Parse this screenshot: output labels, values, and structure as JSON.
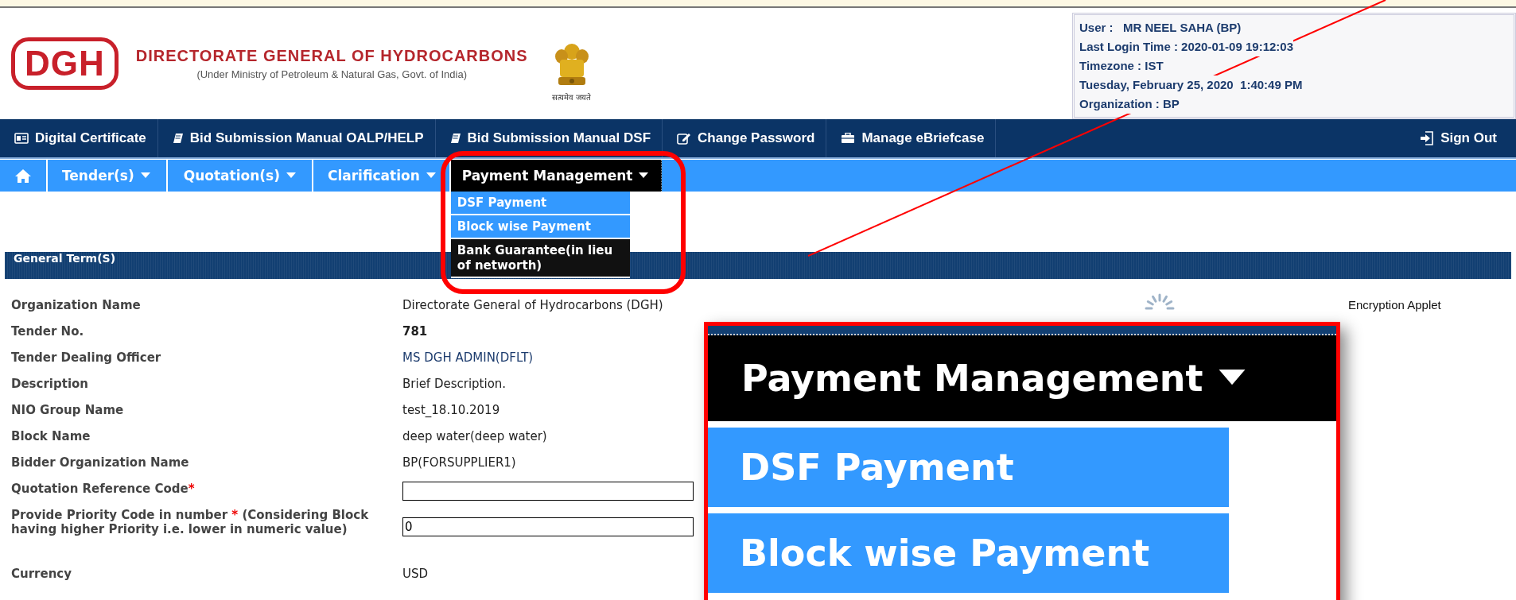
{
  "header": {
    "logo": "DGH",
    "title": "DIRECTORATE GENERAL OF HYDROCARBONS",
    "subtitle": "(Under Ministry of Petroleum & Natural Gas, Govt. of India)",
    "emblem_motto": "सत्यमेव जयते"
  },
  "user_info": [
    "User :   MR NEEL SAHA (BP)",
    "Last Login Time : 2020-01-09 19:12:03",
    "Timezone : IST",
    "Tuesday, February 25, 2020  1:40:49 PM",
    "Organization : BP"
  ],
  "top_nav": [
    {
      "label": "Digital Certificate"
    },
    {
      "label": "Bid Submission Manual OALP/HELP"
    },
    {
      "label": "Bid Submission Manual DSF"
    },
    {
      "label": "Change Password"
    },
    {
      "label": "Manage eBriefcase"
    }
  ],
  "sign_out": "Sign Out",
  "main_menu": [
    {
      "kind": "home",
      "selected": false
    },
    {
      "kind": "dropdown",
      "label": "Tender(s)",
      "selected": false
    },
    {
      "kind": "dropdown",
      "label": "Quotation(s)",
      "selected": false
    },
    {
      "kind": "dropdown",
      "label": "Clarification",
      "selected": false
    },
    {
      "kind": "dropdown",
      "label": "Payment Management",
      "selected": true
    }
  ],
  "dropdown_menu": [
    {
      "label": "DSF Payment",
      "highlighted": true
    },
    {
      "label": "Block wise Payment",
      "highlighted": true
    },
    {
      "label": "Bank Guarantee(in lieu of networth)",
      "highlighted": false
    }
  ],
  "section_title": "General Term(S)",
  "fields": [
    {
      "label": "Organization Name",
      "kind": "text",
      "value": "Directorate General of Hydrocarbons (DGH)"
    },
    {
      "label": "Tender No.",
      "kind": "bold",
      "value": "781"
    },
    {
      "label": "Tender Dealing Officer",
      "kind": "link",
      "value": "MS DGH ADMIN(DFLT)"
    },
    {
      "label": "Description",
      "kind": "text",
      "value": "Brief Description."
    },
    {
      "label": "NIO Group Name",
      "kind": "text",
      "value": "test_18.10.2019"
    },
    {
      "label": "Block Name",
      "kind": "text",
      "value": "deep water(deep water)"
    },
    {
      "label": "Bidder Organization Name",
      "kind": "text",
      "value": "BP(FORSUPPLIER1)"
    },
    {
      "label": "Quotation Reference Code",
      "required_mark": "*",
      "kind": "input"
    },
    {
      "label": "Provide Priority Code in number ",
      "required_mark": "*",
      "label_after": " (Considering Block having higher Priority i.e. lower in numeric value)",
      "kind": "input",
      "value": "0"
    },
    {
      "label": "Currency",
      "kind": "text",
      "value": "USD"
    }
  ],
  "side_note": "Encryption Applet",
  "zoom_inset": {
    "menu_label": "Payment Management",
    "items": [
      {
        "label": "DSF Payment"
      },
      {
        "label": "Block wise Payment"
      }
    ]
  }
}
